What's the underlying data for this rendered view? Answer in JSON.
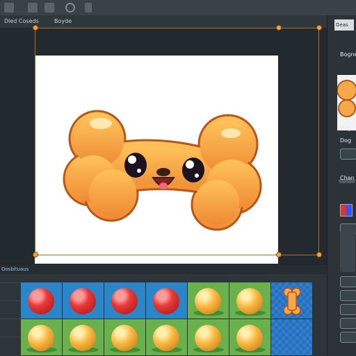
{
  "toolbar": {
    "icons": [
      "app-icon",
      "menu-icon",
      "grid-icon",
      "circle-icon"
    ]
  },
  "menubar": {
    "item1": "Dled Coseds",
    "item2": "Boyde"
  },
  "right_panel": {
    "tab1": "Deas",
    "label_top": "Bogne",
    "label1": "Dog",
    "label2": "Dog",
    "label_bottom": "Chan"
  },
  "bottom_panel": {
    "tab_label": "Oosbituaus"
  },
  "tiles": [
    {
      "bg": "#2a86c8",
      "ball": "red"
    },
    {
      "bg": "#2a86c8",
      "ball": "red"
    },
    {
      "bg": "#2a86c8",
      "ball": "red"
    },
    {
      "bg": "#2a86c8",
      "ball": "red"
    },
    {
      "bg": "#6ab04c",
      "ball": "orange"
    },
    {
      "bg": "#6ab04c",
      "ball": "orange"
    },
    {
      "bg": "#2f7fd0",
      "ball": "bone"
    },
    {
      "bg": "#6ab04c",
      "ball": "orange"
    },
    {
      "bg": "#6ab04c",
      "ball": "orange"
    },
    {
      "bg": "#6ab04c",
      "ball": "orange"
    },
    {
      "bg": "#6ab04c",
      "ball": "orange"
    },
    {
      "bg": "#6ab04c",
      "ball": "orange"
    },
    {
      "bg": "#6ab04c",
      "ball": "orange"
    },
    {
      "bg": "#2f7fd0",
      "ball": "none"
    }
  ],
  "colors": {
    "accent": "#f1a53b",
    "bone_fill": "#f6a94a",
    "bone_stroke": "#b8561a"
  }
}
